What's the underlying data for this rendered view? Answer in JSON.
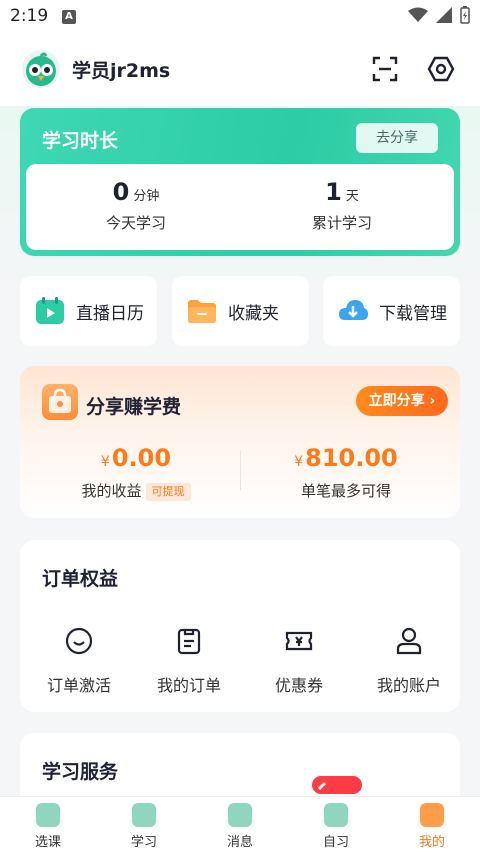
{
  "status_bar": {
    "time": "2:19",
    "notif_badge": "A"
  },
  "header": {
    "username": "学员jr2ms"
  },
  "study_card": {
    "title": "学习时长",
    "share_label": "去分享",
    "today": {
      "value": "0",
      "unit": "分钟",
      "label": "今天学习"
    },
    "total": {
      "value": "1",
      "unit": "天",
      "label": "累计学习"
    }
  },
  "quick_tiles": [
    {
      "label": "直播日历",
      "icon": "calendar-icon"
    },
    {
      "label": "收藏夹",
      "icon": "folder-icon"
    },
    {
      "label": "下载管理",
      "icon": "cloud-download-icon"
    }
  ],
  "earn_card": {
    "title": "分享赚学费",
    "share_now_label": "立即分享",
    "my_income": {
      "currency": "¥",
      "value": "0.00",
      "label": "我的收益",
      "tag": "可提现"
    },
    "max_earn": {
      "currency": "¥",
      "value": "810.00",
      "label": "单笔最多可得"
    }
  },
  "order_card": {
    "title": "订单权益",
    "items": [
      {
        "label": "订单激活",
        "icon": "smile-icon"
      },
      {
        "label": "我的订单",
        "icon": "clipboard-icon"
      },
      {
        "label": "优惠券",
        "icon": "coupon-icon"
      },
      {
        "label": "我的账户",
        "icon": "user-icon"
      }
    ]
  },
  "service_card": {
    "title": "学习服务"
  },
  "tabbar": {
    "items": [
      {
        "label": "选课",
        "active": false
      },
      {
        "label": "学习",
        "active": false
      },
      {
        "label": "消息",
        "active": false
      },
      {
        "label": "自习",
        "active": false
      },
      {
        "label": "我的",
        "active": true
      }
    ]
  },
  "colors": {
    "accent_green": "#2ccca4",
    "accent_orange": "#ff7a1a"
  }
}
